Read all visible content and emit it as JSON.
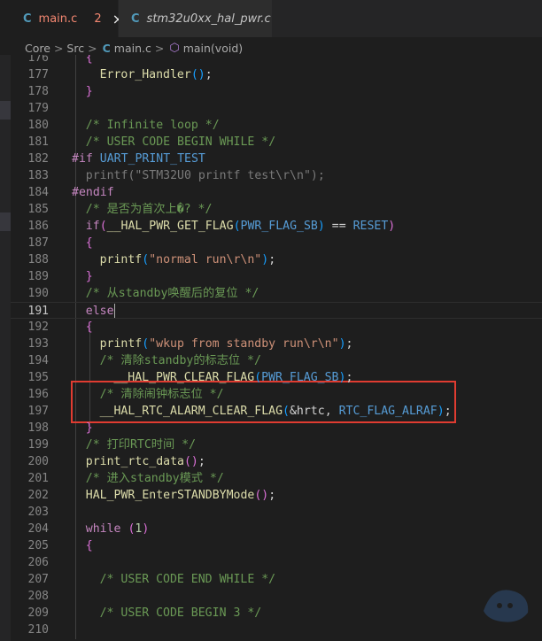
{
  "tabs": [
    {
      "icon": "C",
      "label": "main.c",
      "badge": "2",
      "close": "×"
    },
    {
      "icon": "C",
      "label": "stm32u0xx_hal_pwr.c"
    }
  ],
  "breadcrumb": {
    "items": [
      "Core",
      "Src",
      "main.c",
      "main(void)"
    ],
    "separator": ">",
    "file_icon": "C",
    "symbol_icon": "⬡"
  },
  "editor": {
    "lines": [
      {
        "num": "176",
        "tokens": [
          {
            "t": "{",
            "c": "t-br2"
          }
        ]
      },
      {
        "num": "177",
        "tokens": [
          {
            "t": "Error_Handler",
            "c": "t-fn"
          },
          {
            "t": "()",
            "c": "t-br3"
          },
          {
            "t": ";",
            "c": "t-plain"
          }
        ]
      },
      {
        "num": "178",
        "tokens": [
          {
            "t": "}",
            "c": "t-br2"
          }
        ]
      },
      {
        "num": "179",
        "tokens": []
      },
      {
        "num": "180",
        "tokens": [
          {
            "t": "/* Infinite loop */",
            "c": "t-com"
          }
        ]
      },
      {
        "num": "181",
        "tokens": [
          {
            "t": "/* USER CODE BEGIN WHILE */",
            "c": "t-com"
          }
        ]
      },
      {
        "num": "182",
        "tokens": [
          {
            "t": "#if ",
            "c": "t-pre"
          },
          {
            "t": "UART_PRINT_TEST",
            "c": "t-mac"
          }
        ]
      },
      {
        "num": "183",
        "tokens": [
          {
            "t": "printf",
            "c": "t-dim"
          },
          {
            "t": "(",
            "c": "t-dim"
          },
          {
            "t": "\"STM32U0 printf test\\r\\n\"",
            "c": "t-dim"
          },
          {
            "t": ");",
            "c": "t-dim"
          }
        ]
      },
      {
        "num": "184",
        "tokens": [
          {
            "t": "#endif",
            "c": "t-pre"
          }
        ]
      },
      {
        "num": "185",
        "tokens": [
          {
            "t": "/* 是否为首次上�? */",
            "c": "t-com"
          }
        ]
      },
      {
        "num": "186",
        "tokens": [
          {
            "t": "if",
            "c": "t-kw"
          },
          {
            "t": "(",
            "c": "t-br2"
          },
          {
            "t": "__HAL_PWR_GET_FLAG",
            "c": "t-fn"
          },
          {
            "t": "(",
            "c": "t-br3"
          },
          {
            "t": "PWR_FLAG_SB",
            "c": "t-mac"
          },
          {
            "t": ")",
            "c": "t-br3"
          },
          {
            "t": " == ",
            "c": "t-plain"
          },
          {
            "t": "RESET",
            "c": "t-mac"
          },
          {
            "t": ")",
            "c": "t-br2"
          }
        ]
      },
      {
        "num": "187",
        "tokens": [
          {
            "t": "{",
            "c": "t-br2"
          }
        ]
      },
      {
        "num": "188",
        "tokens": [
          {
            "t": "printf",
            "c": "t-fn"
          },
          {
            "t": "(",
            "c": "t-br3"
          },
          {
            "t": "\"normal run\\r\\n\"",
            "c": "t-str"
          },
          {
            "t": ")",
            "c": "t-br3"
          },
          {
            "t": ";",
            "c": "t-plain"
          }
        ]
      },
      {
        "num": "189",
        "tokens": [
          {
            "t": "}",
            "c": "t-br2"
          }
        ]
      },
      {
        "num": "190",
        "tokens": [
          {
            "t": "/* 从standby唤醒后的复位 */",
            "c": "t-com"
          }
        ]
      },
      {
        "num": "191",
        "tokens": [
          {
            "t": "else",
            "c": "t-kw"
          }
        ]
      },
      {
        "num": "192",
        "tokens": [
          {
            "t": "{",
            "c": "t-br2"
          }
        ]
      },
      {
        "num": "193",
        "tokens": [
          {
            "t": "printf",
            "c": "t-fn"
          },
          {
            "t": "(",
            "c": "t-br3"
          },
          {
            "t": "\"wkup from standby run\\r\\n\"",
            "c": "t-str"
          },
          {
            "t": ")",
            "c": "t-br3"
          },
          {
            "t": ";",
            "c": "t-plain"
          }
        ]
      },
      {
        "num": "194",
        "tokens": [
          {
            "t": "/* 清除standby的标志位 */",
            "c": "t-com"
          }
        ]
      },
      {
        "num": "195",
        "tokens": [
          {
            "t": "__HAL_PWR_CLEAR_FLAG",
            "c": "t-fn"
          },
          {
            "t": "(",
            "c": "t-br3"
          },
          {
            "t": "PWR_FLAG_SB",
            "c": "t-mac"
          },
          {
            "t": ")",
            "c": "t-br3"
          },
          {
            "t": ";",
            "c": "t-plain"
          }
        ]
      },
      {
        "num": "196",
        "tokens": [
          {
            "t": "/* 清除闹钟标志位 */",
            "c": "t-com"
          }
        ]
      },
      {
        "num": "197",
        "tokens": [
          {
            "t": "__HAL_RTC_ALARM_CLEAR_FLAG",
            "c": "t-fn"
          },
          {
            "t": "(",
            "c": "t-br3"
          },
          {
            "t": "&hrtc",
            "c": "t-plain"
          },
          {
            "t": ", ",
            "c": "t-plain"
          },
          {
            "t": "RTC_FLAG_ALRAF",
            "c": "t-mac"
          },
          {
            "t": ")",
            "c": "t-br3"
          },
          {
            "t": ";",
            "c": "t-plain"
          }
        ]
      },
      {
        "num": "198",
        "tokens": [
          {
            "t": "}",
            "c": "t-br2"
          }
        ]
      },
      {
        "num": "199",
        "tokens": [
          {
            "t": "/* 打印RTC时间 */",
            "c": "t-com"
          }
        ]
      },
      {
        "num": "200",
        "tokens": [
          {
            "t": "print_rtc_data",
            "c": "t-fn"
          },
          {
            "t": "()",
            "c": "t-br2"
          },
          {
            "t": ";",
            "c": "t-plain"
          }
        ]
      },
      {
        "num": "201",
        "tokens": [
          {
            "t": "/* 进入standby模式 */",
            "c": "t-com"
          }
        ]
      },
      {
        "num": "202",
        "tokens": [
          {
            "t": "HAL_PWR_EnterSTANDBYMode",
            "c": "t-fn"
          },
          {
            "t": "()",
            "c": "t-br2"
          },
          {
            "t": ";",
            "c": "t-plain"
          }
        ]
      },
      {
        "num": "203",
        "tokens": []
      },
      {
        "num": "204",
        "tokens": [
          {
            "t": "while",
            "c": "t-kw"
          },
          {
            "t": " ",
            "c": "t-plain"
          },
          {
            "t": "(",
            "c": "t-br2"
          },
          {
            "t": "1",
            "c": "t-num"
          },
          {
            "t": ")",
            "c": "t-br2"
          }
        ]
      },
      {
        "num": "205",
        "tokens": [
          {
            "t": "{",
            "c": "t-br2"
          }
        ]
      },
      {
        "num": "206",
        "tokens": []
      },
      {
        "num": "207",
        "tokens": [
          {
            "t": "/* USER CODE END WHILE */",
            "c": "t-com"
          }
        ]
      },
      {
        "num": "208",
        "tokens": []
      },
      {
        "num": "209",
        "tokens": [
          {
            "t": "/* USER CODE BEGIN 3 */",
            "c": "t-com"
          }
        ]
      },
      {
        "num": "210",
        "tokens": []
      }
    ],
    "current_line": "191"
  },
  "colors": {
    "background": "#1e1e1e",
    "tab_modified": "#f48771",
    "c_icon": "#519aba",
    "highlight_box": "#e03c31"
  }
}
